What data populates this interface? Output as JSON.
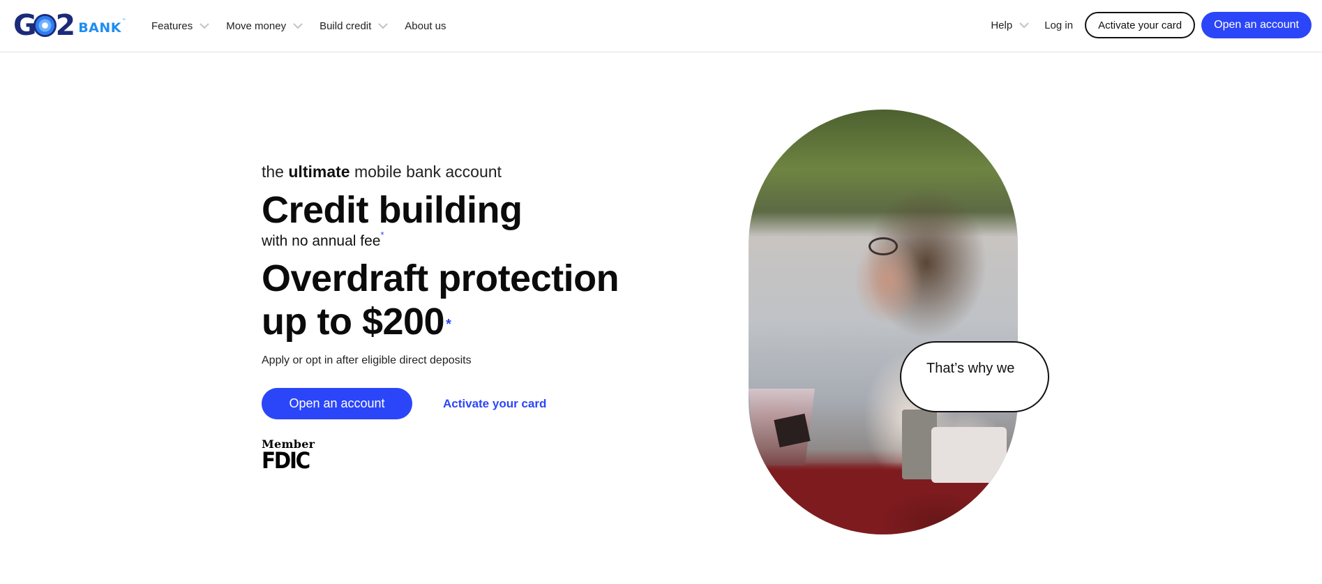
{
  "brand": {
    "logo_primary": "GO2",
    "logo_secondary": "BANK",
    "logo_mark": "™",
    "primary_color": "#2b46f8",
    "logo_navy": "#1b2a7a",
    "logo_blue": "#1f8df0"
  },
  "nav": {
    "left": [
      {
        "label": "Features",
        "has_dropdown": true,
        "icon": "chevron-down-icon"
      },
      {
        "label": "Move money",
        "has_dropdown": true,
        "icon": "chevron-down-icon"
      },
      {
        "label": "Build credit",
        "has_dropdown": true,
        "icon": "chevron-down-icon"
      },
      {
        "label": "About us",
        "has_dropdown": false
      }
    ],
    "help": {
      "label": "Help",
      "has_dropdown": true,
      "icon": "chevron-down-icon"
    },
    "login": "Log in",
    "activate_card": "Activate your card",
    "open_account": "Open an account"
  },
  "hero": {
    "tagline_pre": "the ",
    "tagline_bold": "ultimate",
    "tagline_post": " mobile bank account",
    "headline_1": "Credit building",
    "subline_1": "with no annual fee",
    "subline_1_mark": "*",
    "headline_2_line1": "Overdraft protection",
    "headline_2_line2": "up to $200",
    "headline_2_mark": "*",
    "description": "Apply or opt in after eligible direct deposits",
    "cta_primary": "Open an account",
    "cta_secondary": "Activate your card",
    "fdic_member": "Member",
    "fdic_label": "FDIC"
  },
  "media": {
    "photo_alt": "Woman with glasses laughing holding a cup at a table",
    "speech_bubble": "That’s why we"
  }
}
